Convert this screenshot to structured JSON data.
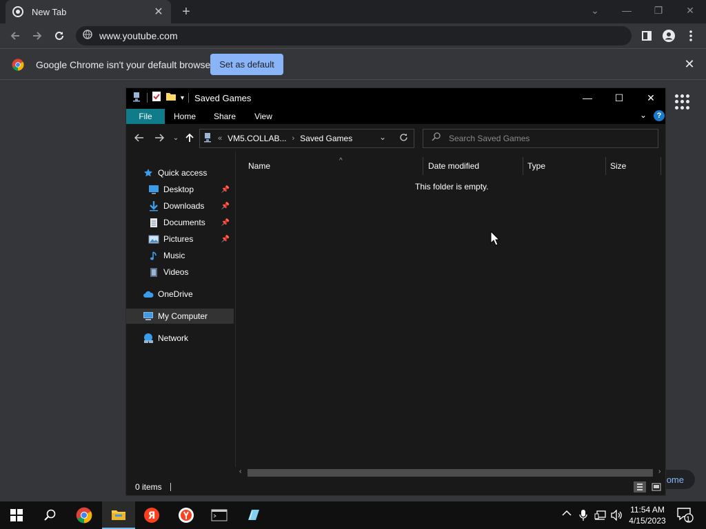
{
  "browser": {
    "tab_title": "New Tab",
    "url": "www.youtube.com",
    "infobar_message": "Google Chrome isn't your default browser",
    "infobar_button": "Set as default",
    "home_pill_text": "ome"
  },
  "explorer": {
    "window_title": "Saved Games",
    "ribbon_tabs": [
      "File",
      "Home",
      "Share",
      "View"
    ],
    "address": {
      "prefix": "«",
      "crumb1": "VM5.COLLAB...",
      "crumb2": "Saved Games"
    },
    "search_placeholder": "Search Saved Games",
    "nav_items": [
      {
        "label": "Quick access",
        "icon": "star-icon",
        "pinned": false
      },
      {
        "label": "Desktop",
        "icon": "desktop-icon",
        "pinned": true
      },
      {
        "label": "Downloads",
        "icon": "download-icon",
        "pinned": true
      },
      {
        "label": "Documents",
        "icon": "documents-icon",
        "pinned": true
      },
      {
        "label": "Pictures",
        "icon": "pictures-icon",
        "pinned": true
      },
      {
        "label": "Music",
        "icon": "music-icon",
        "pinned": false
      },
      {
        "label": "Videos",
        "icon": "videos-icon",
        "pinned": false
      },
      {
        "label": "OneDrive",
        "icon": "onedrive-icon",
        "pinned": false
      },
      {
        "label": "My Computer",
        "icon": "computer-icon",
        "pinned": false,
        "selected": true
      },
      {
        "label": "Network",
        "icon": "network-icon",
        "pinned": false
      }
    ],
    "columns": [
      "Name",
      "Date modified",
      "Type",
      "Size"
    ],
    "empty_message": "This folder is empty.",
    "status": "0 items"
  },
  "taskbar": {
    "time": "11:54 AM",
    "date": "4/15/2023",
    "notification_count": "1"
  },
  "colors": {
    "accent": "#8ab4f8",
    "file_tab": "#107c8a",
    "taskbar_highlight": "#76b9ed"
  }
}
